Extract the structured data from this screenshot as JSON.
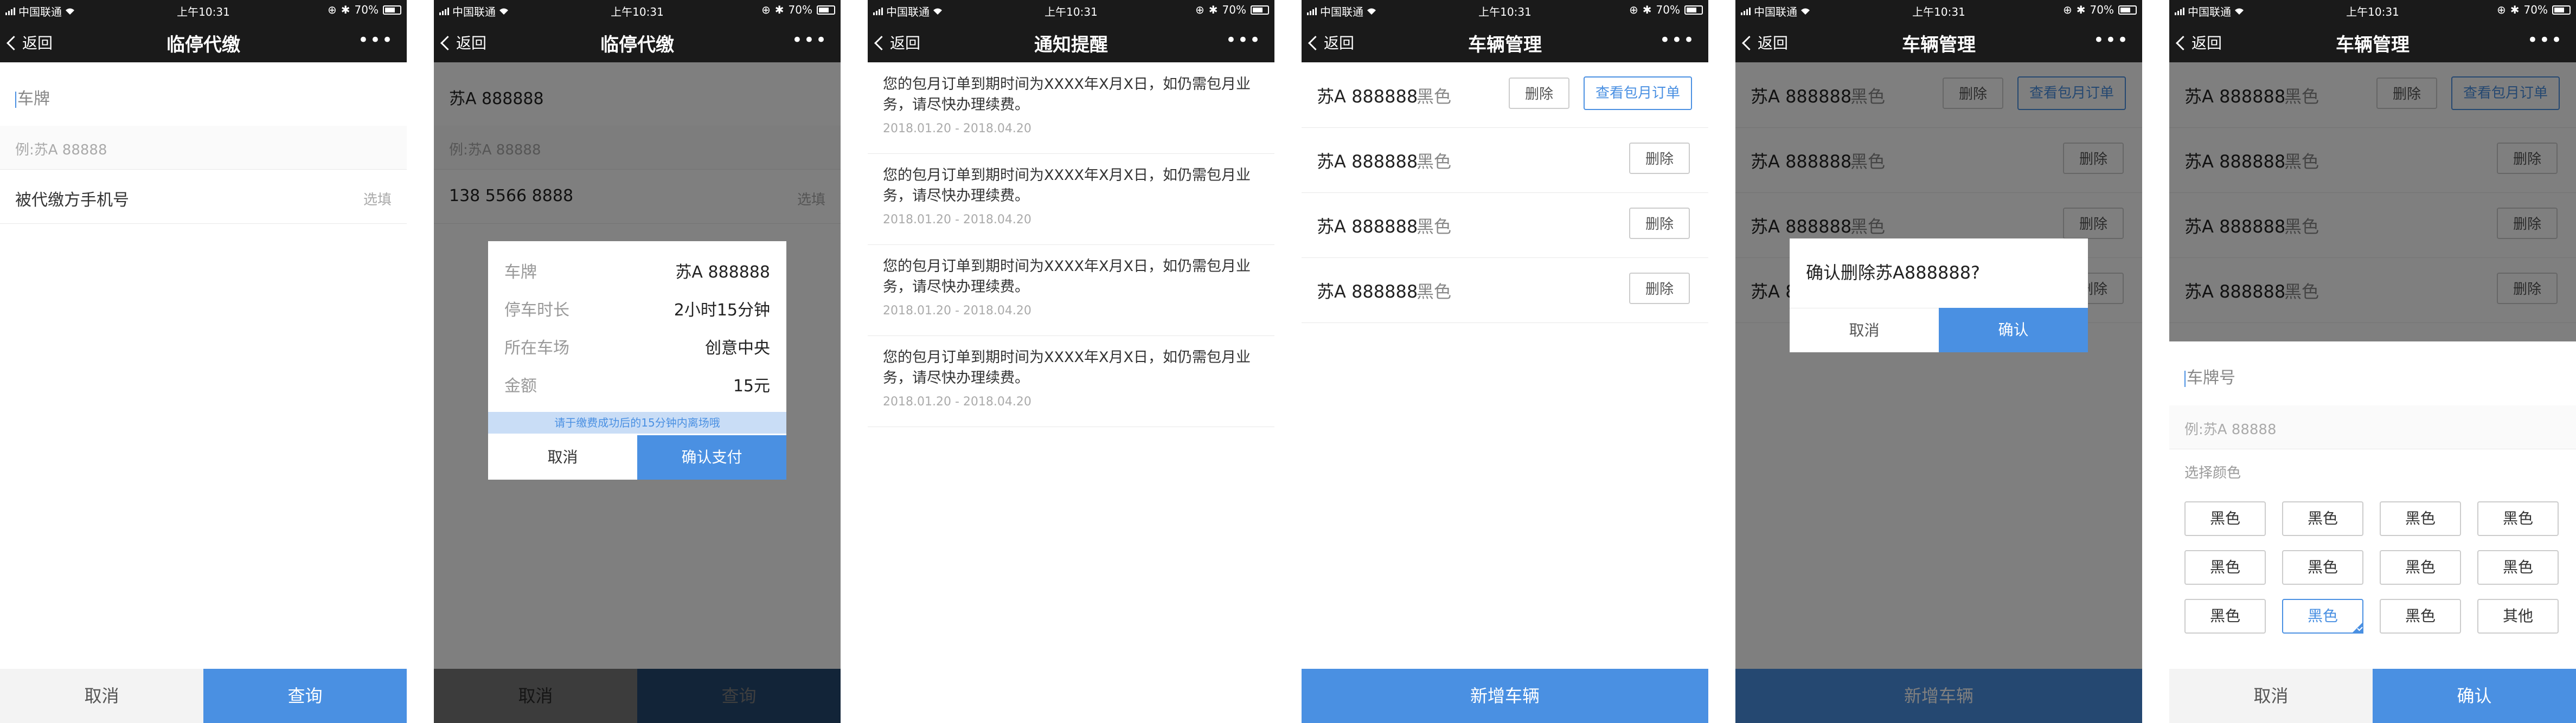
{
  "status": {
    "carrier": "中国联通",
    "time": "上午10:31",
    "battery": "70%"
  },
  "common": {
    "back": "返回",
    "cancel": "取消",
    "more": "•••"
  },
  "screen1": {
    "title": "临停代缴",
    "plate_placeholder": "车牌",
    "plate_example": "例:苏A 88888",
    "phone_label": "被代缴方手机号",
    "phone_optional": "选填",
    "query": "查询"
  },
  "screen2": {
    "title": "临停代缴",
    "plate_value": "苏A 888888",
    "plate_example": "例:苏A 88888",
    "phone_value": "138  5566  8888",
    "phone_optional": "选填",
    "query": "查询",
    "modal": {
      "rows": [
        {
          "label": "车牌",
          "value": "苏A  888888"
        },
        {
          "label": "停车时长",
          "value": "2小时15分钟"
        },
        {
          "label": "所在车场",
          "value": "创意中央"
        },
        {
          "label": "金额",
          "value": "15元"
        }
      ],
      "notice": "请于缴费成功后的15分钟内离场哦",
      "cancel": "取消",
      "confirm": "确认支付"
    }
  },
  "screen3": {
    "title": "通知提醒",
    "items": [
      {
        "text": "您的包月订单到期时间为XXXX年X月X日，如仍需包月业务，请尽快办理续费。",
        "date": "2018.01.20 - 2018.04.20"
      },
      {
        "text": "您的包月订单到期时间为XXXX年X月X日，如仍需包月业务，请尽快办理续费。",
        "date": "2018.01.20 - 2018.04.20"
      },
      {
        "text": "您的包月订单到期时间为XXXX年X月X日，如仍需包月业务，请尽快办理续费。",
        "date": "2018.01.20 - 2018.04.20"
      },
      {
        "text": "您的包月订单到期时间为XXXX年X月X日，如仍需包月业务，请尽快办理续费。",
        "date": "2018.01.20 - 2018.04.20"
      }
    ]
  },
  "screen4": {
    "title": "车辆管理",
    "vehicles": [
      {
        "plate": "苏A 888888",
        "color": "黑色"
      },
      {
        "plate": "苏A 888888",
        "color": "黑色"
      },
      {
        "plate": "苏A 888888",
        "color": "黑色"
      },
      {
        "plate": "苏A 888888",
        "color": "黑色"
      }
    ],
    "delete": "删除",
    "view_monthly": "查看包月订单",
    "add": "新增车辆"
  },
  "screen5": {
    "title": "车辆管理",
    "dialog_message": "确认删除苏A888888?",
    "dialog_cancel": "取消",
    "dialog_confirm": "确认"
  },
  "screen6": {
    "title": "车辆管理",
    "plate_label": "车牌号",
    "plate_example": "例:苏A 88888",
    "color_label": "选择颜色",
    "colors": [
      "黑色",
      "黑色",
      "黑色",
      "黑色",
      "黑色",
      "黑色",
      "黑色",
      "黑色",
      "黑色",
      "黑色",
      "黑色",
      "其他"
    ],
    "selected_color_index": 9,
    "confirm": "确认"
  }
}
